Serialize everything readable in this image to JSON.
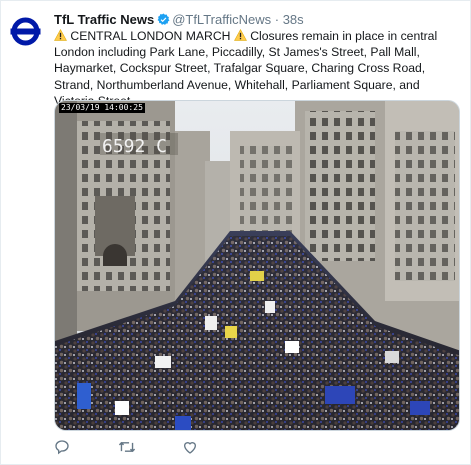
{
  "tweet": {
    "display_name": "TfL Traffic News",
    "handle": "@TfLTrafficNews",
    "separator": "·",
    "time": "38s",
    "text_part1": " CENTRAL LONDON MARCH ",
    "text_part2": " Closures remain in place in central London including Park Lane, Piccadilly, St James's Street, Pall Mall, Haymarket, Cockspur Street, Trafalgar Square, Charing Cross Road, Strand, Northumberland Avenue, Whitehall, Parliament Square, and Victoria Street."
  },
  "media": {
    "timestamp": "23/03/19 14:00:25",
    "sign_text": "6592 C",
    "description_icon": "cctv-crowd-photo"
  },
  "colors": {
    "brand_blue": "#1da1f2",
    "tfl_blue": "#0019a8",
    "warning_yellow": "#ffcc4d",
    "action_gray": "#657786"
  },
  "icons": {
    "avatar": "tfl-roundel-icon",
    "verified": "verified-badge-icon",
    "warning": "warning-icon",
    "reply": "reply-icon",
    "retweet": "retweet-icon",
    "like": "heart-icon"
  }
}
